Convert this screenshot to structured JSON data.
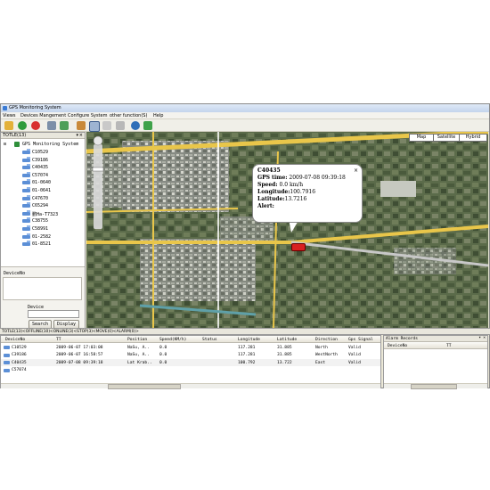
{
  "window": {
    "title": "GPS Monitoring System"
  },
  "menu": [
    "Views",
    "Devices Mangement",
    "Configure System",
    "other function(S)",
    "Help"
  ],
  "toolbar_icons": [
    "home-icon",
    "check-icon",
    "stop-icon",
    "tools-icon",
    "network-icon",
    "camera-icon",
    "cursor-icon",
    "zoom-icon",
    "ruler-icon",
    "globe-icon",
    "refresh-icon"
  ],
  "left_panel": {
    "title": "TOTLE(13)",
    "root": "GPS Monitoring System",
    "devices": [
      "C10529",
      "C39186",
      "C40435",
      "C57074",
      "01-0640",
      "01-0641",
      "C47670",
      "C65294",
      "鹏Ha-T7323",
      "C38755",
      "C58991",
      "01-2582",
      "01-8521"
    ],
    "list_label": "DeviceNo",
    "search_label": "Device",
    "search_value": "",
    "search_button": "Search",
    "display_button": "Display"
  },
  "map": {
    "types": [
      "Map",
      "Satellite",
      "Hybrid"
    ],
    "popup": {
      "device": "C40435",
      "gps_time_label": "GPS time:",
      "gps_time": "2009-07-08 09:39:18",
      "speed_label": "Speed:",
      "speed": "0.0 km/h",
      "longitude_label": "Longitude:",
      "longitude": "100.7916",
      "latitude_label": "Latitude:",
      "latitude": "13.7216",
      "alert_label": "Alert:",
      "alert": ""
    }
  },
  "status_tabs": "TOTLE(13)<OFFLINE(10)<ONLINE(3)<STOP(3)<MOVE(0)<ALARM(0)>",
  "grid": {
    "columns": [
      "DeviceNo",
      "TT",
      "Position",
      "Speed(KM/h)",
      "Status",
      "Longitude",
      "Latitude",
      "Direction",
      "Gps Signal"
    ],
    "rows": [
      [
        "C10529",
        "2009-06-07 17:03:08",
        "NaSu, A..",
        "0.0",
        "",
        "117.281",
        "31.885",
        "North",
        "Valid"
      ],
      [
        "C39186",
        "2009-06-07 16:58:57",
        "NaSu, A..",
        "0.0",
        "",
        "117.281",
        "31.885",
        "WestNorth",
        "Valid"
      ],
      [
        "C40435",
        "2009-07-08 09:39:18",
        "Lat Krab..",
        "0.0",
        "",
        "100.792",
        "13.722",
        "East",
        "Valid"
      ],
      [
        "C57074",
        "",
        "",
        "",
        "",
        "",
        "",
        "",
        ""
      ]
    ]
  },
  "alarm": {
    "title": "Alarm Records",
    "columns": [
      "DeviceNo",
      "TT"
    ]
  },
  "colors": {
    "accent": "#3a7bd5",
    "marker": "#d82020",
    "map_bg": "#4e5a44"
  }
}
